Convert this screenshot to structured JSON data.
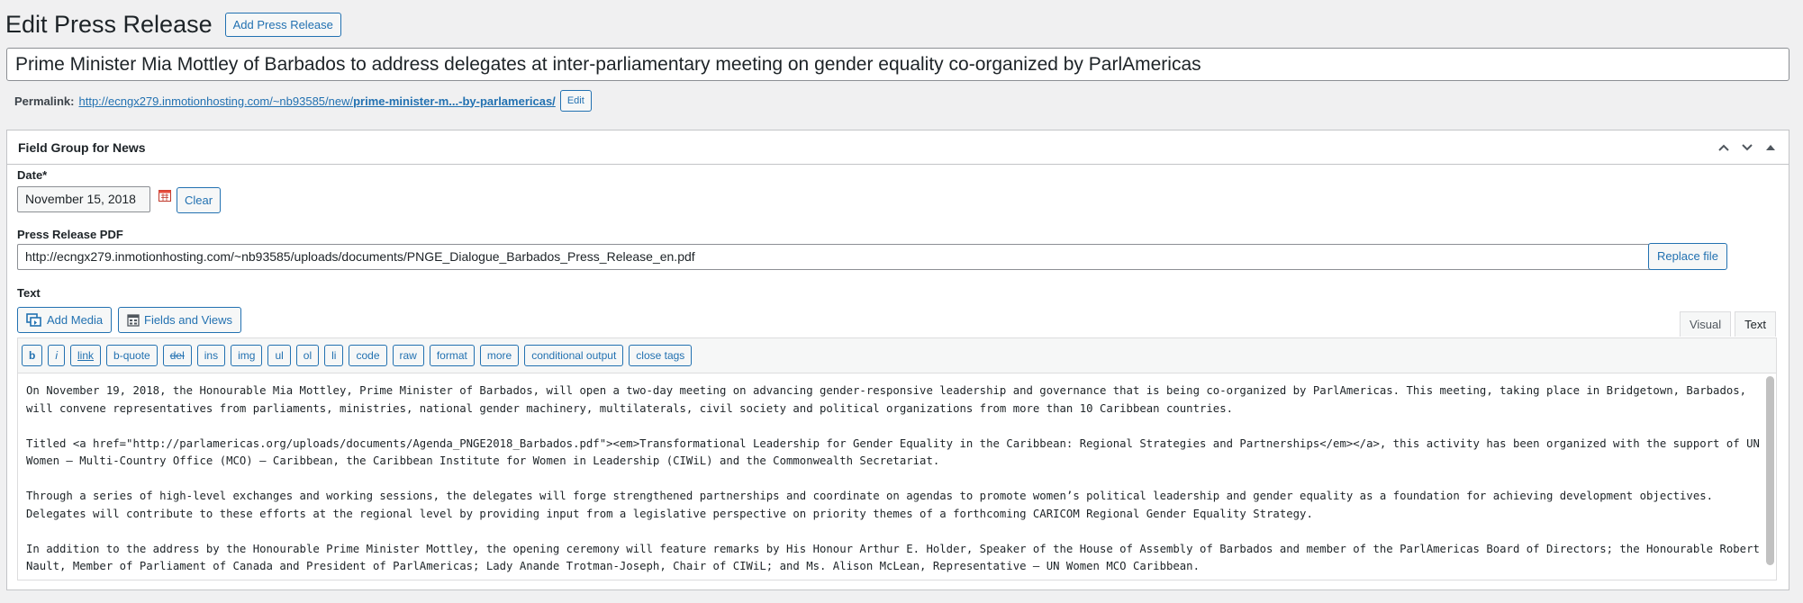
{
  "header": {
    "title": "Edit Press Release",
    "add_new_label": "Add Press Release"
  },
  "post_title": "Prime Minister Mia Mottley of Barbados to address delegates at inter-parliamentary meeting on gender equality co-organized by ParlAmericas",
  "permalink": {
    "label": "Permalink:",
    "url_base": "http://ecngx279.inmotionhosting.com/~nb93585/new/",
    "slug": "prime-minister-m...-by-parlamericas/",
    "edit_label": "Edit"
  },
  "postbox": {
    "title": "Field Group for News",
    "date_label": "Date*",
    "date_value": "November 15, 2018",
    "clear_label": "Clear",
    "pdf_label": "Press Release PDF",
    "pdf_value": "http://ecngx279.inmotionhosting.com/~nb93585/uploads/documents/PNGE_Dialogue_Barbados_Press_Release_en.pdf",
    "replace_label": "Replace file",
    "text_label": "Text",
    "add_media_label": "Add Media",
    "fields_views_label": "Fields and Views",
    "tab_visual": "Visual",
    "tab_text": "Text"
  },
  "toolbar": [
    "b",
    "i",
    "link",
    "b-quote",
    "del",
    "ins",
    "img",
    "ul",
    "ol",
    "li",
    "code",
    "raw",
    "format",
    "more",
    "conditional output",
    "close tags"
  ],
  "editor_paragraphs": [
    "On November 19, 2018, the Honourable Mia Mottley, Prime Minister of Barbados, will open a two-day meeting on advancing gender-responsive leadership and governance that is being co-organized by ParlAmericas. This meeting, taking place in Bridgetown, Barbados, will convene representatives from parliaments, ministries, national gender machinery, multilaterals, civil society and political organizations from more than 10 Caribbean countries.",
    "Titled <a href=\"http://parlamericas.org/uploads/documents/Agenda_PNGE2018_Barbados.pdf\"><em>Transformational Leadership for Gender Equality in the Caribbean: Regional Strategies and Partnerships</em></a>, this activity has been organized with the support of UN Women – Multi-Country Office (MCO) – Caribbean, the Caribbean Institute for Women in Leadership (CIWiL) and the Commonwealth Secretariat.",
    "Through a series of high-level exchanges and working sessions, the delegates will forge strengthened partnerships and coordinate on agendas to promote women’s political leadership and gender equality as a foundation for achieving development objectives. Delegates will contribute to these efforts at the regional level by providing input from a legislative perspective on priority themes of a forthcoming CARICOM Regional Gender Equality Strategy.",
    "In addition to the address by the Honourable Prime Minister Mottley, the opening ceremony will feature remarks by His Honour Arthur E. Holder, Speaker of the House of Assembly of Barbados and member of the ParlAmericas Board of Directors; the Honourable Robert Nault, Member of Parliament of Canada and President of ParlAmericas; Lady Anande Trotman-Joseph, Chair of CIWiL; and Ms. Alison McLean, Representative – UN Women MCO Caribbean."
  ]
}
